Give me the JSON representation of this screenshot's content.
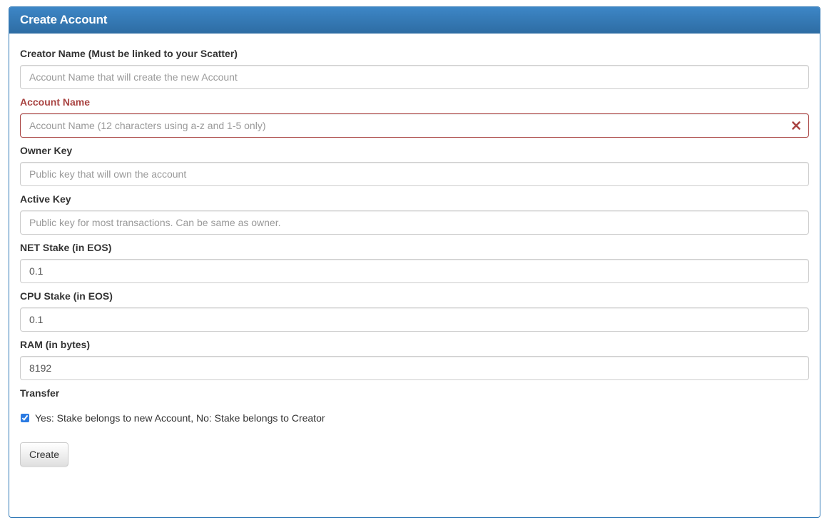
{
  "panel": {
    "title": "Create Account"
  },
  "form": {
    "creator": {
      "label": "Creator Name (Must be linked to your Scatter)",
      "placeholder": "Account Name that will create the new Account",
      "value": ""
    },
    "account_name": {
      "label": "Account Name",
      "placeholder": "Account Name (12 characters using a-z and 1-5 only)",
      "value": "",
      "error_icon": "close-icon"
    },
    "owner_key": {
      "label": "Owner Key",
      "placeholder": "Public key that will own the account",
      "value": ""
    },
    "active_key": {
      "label": "Active Key",
      "placeholder": "Public key for most transactions. Can be same as owner.",
      "value": ""
    },
    "net_stake": {
      "label": "NET Stake (in EOS)",
      "value": "0.1"
    },
    "cpu_stake": {
      "label": "CPU Stake (in EOS)",
      "value": "0.1"
    },
    "ram": {
      "label": "RAM (in bytes)",
      "value": "8192"
    },
    "transfer": {
      "label": "Transfer",
      "checkbox_label": "Yes: Stake belongs to new Account, No: Stake belongs to Creator",
      "checked": true
    },
    "submit_label": "Create"
  },
  "colors": {
    "heading_bg": "#337ab7",
    "error": "#a94442",
    "checkbox": "#2a7ae2"
  }
}
